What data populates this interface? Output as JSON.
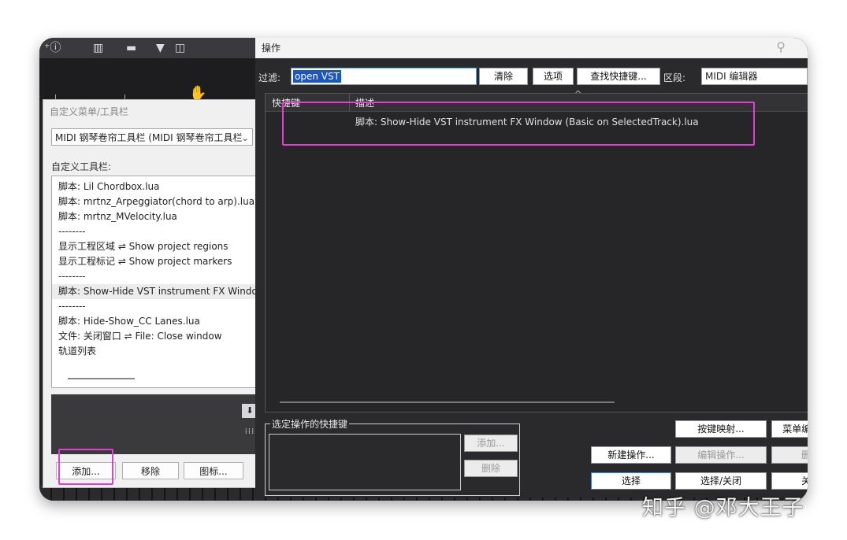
{
  "customize_panel": {
    "title": "自定义菜单/工具栏",
    "toolbar_select": "MIDI 钢琴卷帘工具栏 (MIDI 钢琴卷帘工具栏",
    "toolbar_label": "自定义工具栏:",
    "items": [
      "脚本: Lil Chordbox.lua",
      "脚本: mrtnz_Arpeggiator(chord to arp).lua",
      "脚本: mrtnz_MVelocity.lua",
      "--------",
      "显示工程区域 ⇌ Show project regions",
      "显示工程标记 ⇌ Show project markers",
      "--------",
      "脚本: Show-Hide VST instrument FX Window",
      "--------",
      "脚本: Hide-Show_CC Lanes.lua",
      "文件: 关闭窗口 ⇌ File: Close window",
      "轨道列表"
    ],
    "add_button": "添加...",
    "remove_button": "移除",
    "icon_button": "图标..."
  },
  "actions": {
    "title": "操作",
    "filter_label": "过滤:",
    "filter_value": "open VST",
    "clear_button": "清除",
    "options_button": "选项",
    "find_shortcut_button": "查找快捷键...",
    "section_label": "区段:",
    "section_value": "MIDI 编辑器",
    "col_shortcut": "快捷键",
    "col_description": "描述",
    "rows": [
      "脚本: Show-Hide VST instrument FX Window (Basic on SelectedTrack).lua"
    ],
    "shortcuts_group": "选定操作的快捷键",
    "sc_add_button": "添加...",
    "sc_delete_button": "删除",
    "key_mapping_button": "按键映射...",
    "menu_editor_button": "菜单编辑器...",
    "new_action_button": "新建操作...",
    "edit_action_button": "编辑操作...",
    "delete_button": "删除",
    "select_button": "选择",
    "select_close_button": "选择/关闭",
    "close_button": "关闭"
  },
  "watermark": "知乎 @邓大王子",
  "colors": {
    "highlight": "#e13fd4",
    "dark_bg": "#2a2a2d",
    "selection": "#1a56c4"
  }
}
